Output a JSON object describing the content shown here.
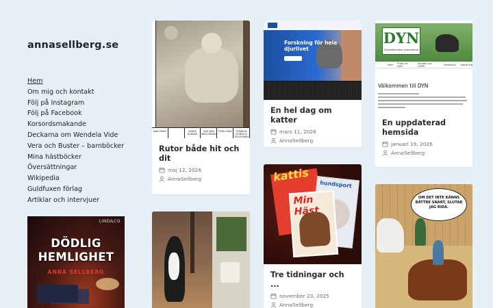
{
  "site": {
    "title": "annasellberg.se"
  },
  "nav": [
    "Hem",
    "Om mig och kontakt",
    "Följ på Instagram",
    "Följ på Facebook",
    "Korsordsmakande",
    "Deckarna om Wendela Vide",
    "Vera och Buster – barnböcker",
    "Mina hästböcker",
    "Översättningar",
    "Wikipedia",
    "Guldfuxen förlag",
    "Artiklar och intervjuer"
  ],
  "book": {
    "publisher": "LIND&CO",
    "title_line1": "DÖDLIG",
    "title_line2": "HEMLIGHET",
    "author": "ANNA SELLBERG"
  },
  "posts": [
    {
      "title": "Rutor både hit och dit",
      "date": "maj 12, 2026",
      "author": "AnnaSellberg",
      "image": "statue-crossword",
      "strip": [
        "KAN ÖMAR",
        "",
        "HYADE KURVAN",
        "VAR DEN MED UDDEN",
        "FÖRA HÄVA",
        "FÖRBJUD NORDICA TELEFONEN"
      ]
    },
    {
      "title": "En hel dag om katter",
      "date": "mars 11, 2026",
      "author": "AnnaSellberg",
      "image": "laptop-webinar",
      "screen_text_1": "Forskning för hela",
      "screen_text_2": "djurlivet"
    },
    {
      "title": "En uppdaterad hemsida",
      "date": "januari 19, 2026",
      "author": "AnnaSellberg",
      "image": "dyn-website",
      "logo_text": "DYN",
      "logo_sub": "Djurbeteendets yrkesnämnd",
      "nav_items": [
        "Hem",
        "Prata om DYN",
        "Kontakt och GDPR",
        "Föreläsare",
        "Utbildning"
      ],
      "heading": "Välkommen till DYN"
    },
    {
      "title": "Tre tidningar och ...",
      "date": "november 23, 2025",
      "author": "AnnaSellberg",
      "image": "magazines",
      "mag1": "kattis",
      "mag2": "Min Häst",
      "mag3": "hundsport"
    },
    {
      "title": "",
      "date": "",
      "author": "",
      "image": "dog-collage"
    },
    {
      "title": "",
      "date": "",
      "author": "",
      "image": "comic-riding",
      "bubble": "OM DET INTE KÄNNS BÄTTRE SNART, SLUTAR JAG RIDA."
    }
  ]
}
